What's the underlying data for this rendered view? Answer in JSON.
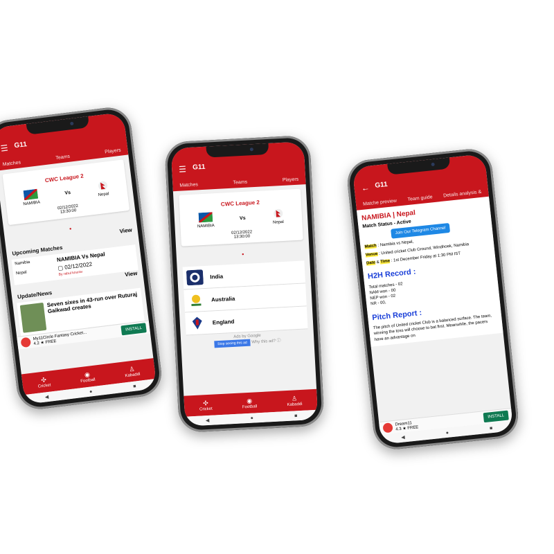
{
  "app": {
    "title": "G11",
    "menu_icon": "hamburger-icon"
  },
  "phone1": {
    "tabs": [
      "Matches",
      "Teams",
      "Players"
    ],
    "league": "CWC League 2",
    "team1": "NAMIBIA",
    "team2": "Nepal",
    "vs": "Vs",
    "date": "02/12/2022",
    "time": "13:30:00",
    "view": "View",
    "upcoming_title": "Upcoming Matches",
    "upcoming": {
      "team1": "Namibia",
      "team2": "Nepal",
      "title": "NAMIBIA Vs Nepal",
      "date": "02/12/2022",
      "by": "By rahul kourav"
    },
    "news_title": "Update/News",
    "news_text": "Seven sixes in 43-run over Ruturaj Gaikwad creates",
    "ad": {
      "name": "My11Circle Fantasy Cricket...",
      "rating": "4.2 ★ FREE",
      "install": "INSTALL"
    },
    "nav": [
      "Cricket",
      "Football",
      "Kabaddi"
    ]
  },
  "phone2": {
    "tabs": [
      "Matches",
      "Teams",
      "Players"
    ],
    "league": "CWC League 2",
    "team1": "NAMIBIA",
    "team2": "Nepal",
    "vs": "Vs",
    "date": "02/12/2022",
    "time": "13:30:00",
    "countries": [
      "India",
      "Australia",
      "England"
    ],
    "ads_by": "Ads by Google",
    "stop_ad": "Stop seeing this ad",
    "why_ad": "Why this ad? ⓘ",
    "nav": [
      "Cricket",
      "Football",
      "Kabaddi"
    ]
  },
  "phone3": {
    "tabs": [
      "Matche preview",
      "Team guide",
      "Details analysis &"
    ],
    "heading": "NAMIBIA | Nepal",
    "status": "Match Status - Active",
    "telegram": "Join Our Telegram Channel",
    "match_label": "Match",
    "match_value": ": Namibia vs Nepal,",
    "venue_label": "Venue",
    "venue_value": ": United cricket Club Ground, Windhoek, Namibia",
    "datetime_label": "Date",
    "datetime_amp": "&",
    "time_label": "Time",
    "datetime_value": ": 1st December Friday at 1:30 PM IST",
    "h2h_title": "H2H Record :",
    "h2h": [
      "Total matches - 02",
      "NAM won - 00",
      "NEP won - 02",
      "NR - 00,"
    ],
    "pitch_title": "Pitch Report :",
    "pitch_text": "The pitch of United cricket Club is a balanced surface. The team, winning the toss will choose to bat first. Meanwhile, the pacers have an advantage on",
    "ad": {
      "name": "Dream11",
      "rating": "4.3 ★ FREE",
      "install": "INSTALL"
    }
  }
}
